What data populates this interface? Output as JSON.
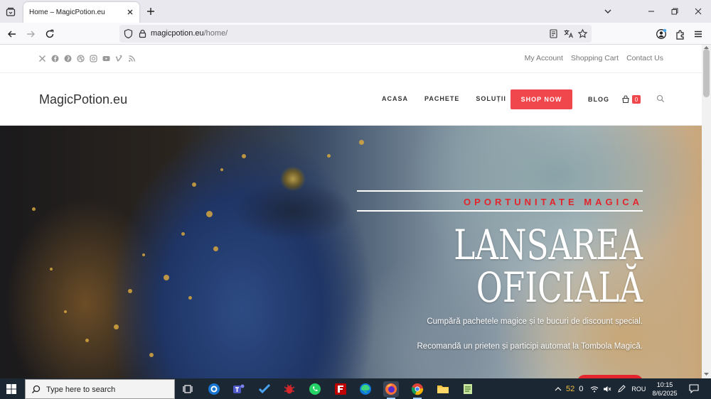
{
  "browser": {
    "tab_title": "Home – MagicPotion.eu",
    "url_host": "magicpotion.eu",
    "url_path": "/home/"
  },
  "site": {
    "topbar": {
      "social_icons": [
        "x-icon",
        "facebook-icon",
        "pinterest-icon",
        "dribbble-icon",
        "instagram-icon",
        "youtube-icon",
        "vimeo-icon",
        "rss-icon"
      ],
      "links": [
        "My Account",
        "Shopping Cart",
        "Contact Us"
      ]
    },
    "logo": "MagicPotion.eu",
    "nav": {
      "items": [
        "ACASA",
        "PACHETE",
        "SOLUȚII"
      ],
      "shop_now": "SHOP NOW",
      "blog": "BLOG",
      "cart_count": "0"
    },
    "hero": {
      "eyebrow": "OPORTUNITATE MAGICA",
      "headline_line1": "LANSAREA",
      "headline_line2": "OFICIALĂ",
      "text1": "Cumpără pachetele magice și te bucuri de discount special.",
      "text2": "Recomandă un prieten și participi automat la Tombola Magică."
    }
  },
  "taskbar": {
    "search_placeholder": "Type here to search",
    "tray": {
      "temperature": "52",
      "weather_extra": "0",
      "language": "ROU"
    },
    "time": "10:15",
    "date": "8/6/2025"
  },
  "colors": {
    "accent": "#f0474c",
    "hero_red": "#e3242b",
    "taskbar": "#1c2734"
  }
}
